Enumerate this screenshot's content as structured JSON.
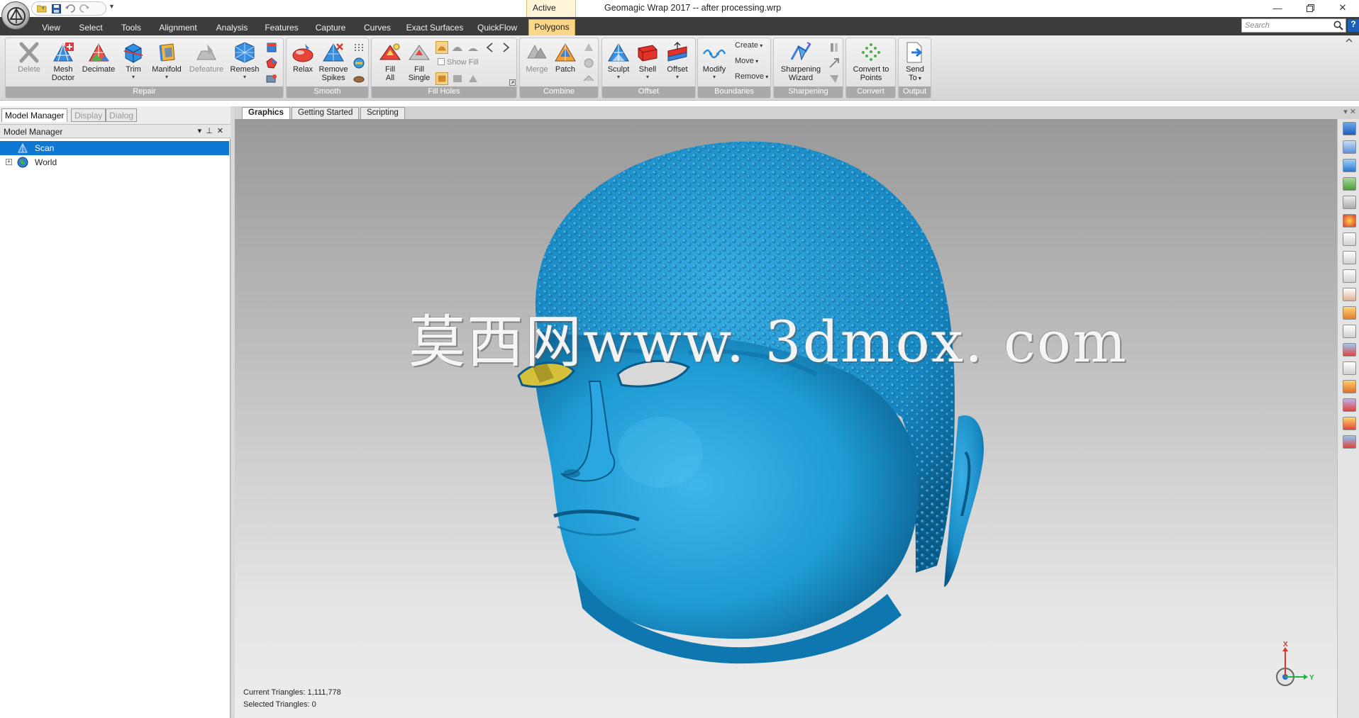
{
  "window": {
    "title": "Geomagic Wrap 2017 -- after processing.wrp",
    "context_tab_label": "Active",
    "controls": [
      "minimize",
      "restore",
      "close"
    ]
  },
  "ribbon_tabs": [
    {
      "label": "View",
      "active": false
    },
    {
      "label": "Select",
      "active": false
    },
    {
      "label": "Tools",
      "active": false
    },
    {
      "label": "Alignment",
      "active": false
    },
    {
      "label": "Analysis",
      "active": false
    },
    {
      "label": "Features",
      "active": false
    },
    {
      "label": "Capture",
      "active": false
    },
    {
      "label": "Curves",
      "active": false
    },
    {
      "label": "Exact Surfaces",
      "active": false
    },
    {
      "label": "QuickFlow",
      "active": false
    },
    {
      "label": "Polygons",
      "active": true
    }
  ],
  "search": {
    "placeholder": "Search"
  },
  "help_label": "?",
  "ribbon": {
    "repair": {
      "label": "Repair",
      "delete": "Delete",
      "mesh_doctor_1": "Mesh",
      "mesh_doctor_2": "Doctor",
      "decimate": "Decimate",
      "trim": "Trim",
      "manifold": "Manifold",
      "defeature": "Defeature",
      "remesh": "Remesh"
    },
    "smooth": {
      "label": "Smooth",
      "relax": "Relax",
      "remove_spikes_1": "Remove",
      "remove_spikes_2": "Spikes"
    },
    "fill_holes": {
      "label": "Fill Holes",
      "fill_all_1": "Fill",
      "fill_all_2": "All",
      "fill_single_1": "Fill",
      "fill_single_2": "Single",
      "show_fill": "Show Fill"
    },
    "combine": {
      "label": "Combine",
      "merge": "Merge",
      "patch": "Patch"
    },
    "offset": {
      "label": "Offset",
      "sculpt": "Sculpt",
      "shell": "Shell",
      "offset": "Offset"
    },
    "boundaries": {
      "label": "Boundaries",
      "modify": "Modify",
      "create": "Create",
      "move": "Move",
      "remove": "Remove"
    },
    "sharpening": {
      "label": "Sharpening",
      "wizard_1": "Sharpening",
      "wizard_2": "Wizard"
    },
    "convert": {
      "label": "Convert",
      "to_points_1": "Convert to",
      "to_points_2": "Points"
    },
    "output": {
      "label": "Output",
      "send_to_1": "Send",
      "send_to_2": "To"
    }
  },
  "left_panel": {
    "tabs": [
      "Model Manager",
      "Display",
      "Dialog"
    ],
    "header": "Model Manager",
    "tree": [
      {
        "label": "Scan",
        "selected": true
      },
      {
        "label": "World",
        "selected": false
      }
    ]
  },
  "doc_tabs": [
    "Graphics",
    "Getting Started",
    "Scripting"
  ],
  "viewport": {
    "watermark": "莫西网www. 3dmox. com",
    "current_triangles": "Current Triangles: 1,111,778",
    "selected_triangles": "Selected Triangles: 0",
    "triad": {
      "x_label": "X",
      "y_label": "Y"
    },
    "colors": {
      "mesh": "#1e9bd4",
      "mesh_dark": "#0a5e8a",
      "eye_patch": "#d6c23a"
    }
  }
}
